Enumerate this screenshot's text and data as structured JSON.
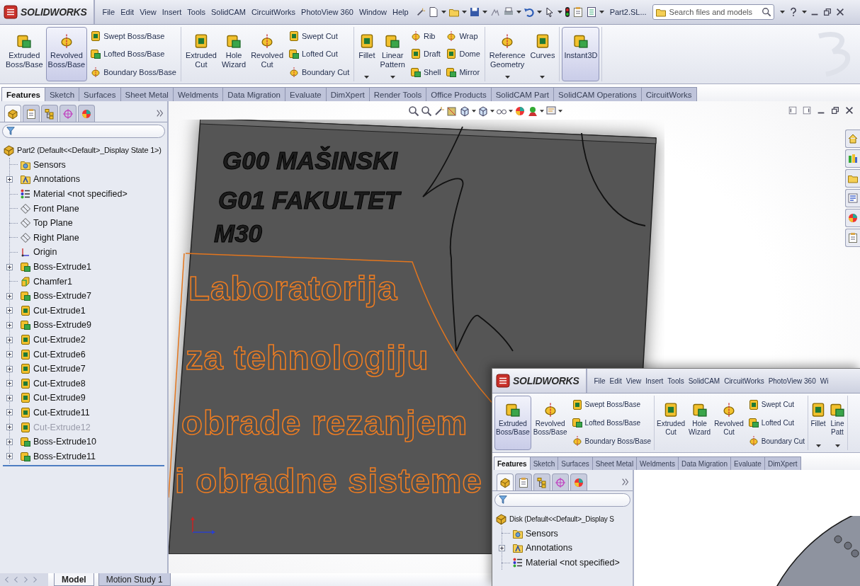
{
  "main_window": {
    "title_bar": {
      "app_name": "SOLIDWORKS",
      "menu": [
        "File",
        "Edit",
        "View",
        "Insert",
        "Tools",
        "SolidCAM",
        "CircuitWorks",
        "PhotoView 360",
        "Window",
        "Help"
      ],
      "document_title": "Part2.SL...",
      "search_placeholder": "Search files and models"
    },
    "ribbon": {
      "groups": [
        {
          "items": [
            {
              "kind": "large",
              "label": "Extruded Boss/Base",
              "selected": false,
              "has_menu": false
            },
            {
              "kind": "large",
              "label": "Revolved Boss/Base",
              "selected": true,
              "has_menu": false
            },
            {
              "kind": "stack",
              "buttons": [
                "Swept Boss/Base",
                "Lofted Boss/Base",
                "Boundary Boss/Base"
              ]
            }
          ]
        },
        {
          "items": [
            {
              "kind": "large",
              "label": "Extruded Cut",
              "selected": false,
              "has_menu": false
            },
            {
              "kind": "large",
              "label": "Hole Wizard",
              "selected": false,
              "has_menu": false
            },
            {
              "kind": "large",
              "label": "Revolved Cut",
              "selected": false,
              "has_menu": false
            },
            {
              "kind": "stack",
              "buttons": [
                "Swept Cut",
                "Lofted Cut",
                "Boundary Cut"
              ]
            }
          ]
        },
        {
          "items": [
            {
              "kind": "large",
              "label": "Fillet",
              "selected": false,
              "has_menu": true
            },
            {
              "kind": "large",
              "label": "Linear Pattern",
              "selected": false,
              "has_menu": true
            },
            {
              "kind": "stack",
              "buttons": [
                "Rib",
                "Draft",
                "Shell"
              ]
            },
            {
              "kind": "stack",
              "buttons": [
                "Wrap",
                "Dome",
                "Mirror"
              ]
            }
          ]
        },
        {
          "items": [
            {
              "kind": "large",
              "label": "Reference Geometry",
              "selected": false,
              "has_menu": true
            },
            {
              "kind": "large",
              "label": "Curves",
              "selected": false,
              "has_menu": true
            }
          ]
        },
        {
          "items": [
            {
              "kind": "large",
              "label": "Instant3D",
              "selected": true,
              "has_menu": false
            }
          ]
        }
      ]
    },
    "command_tabs": [
      {
        "label": "Features",
        "selected": true
      },
      {
        "label": "Sketch",
        "selected": false
      },
      {
        "label": "Surfaces",
        "selected": false
      },
      {
        "label": "Sheet Metal",
        "selected": false
      },
      {
        "label": "Weldments",
        "selected": false
      },
      {
        "label": "Data Migration",
        "selected": false
      },
      {
        "label": "Evaluate",
        "selected": false
      },
      {
        "label": "DimXpert",
        "selected": false
      },
      {
        "label": "Render Tools",
        "selected": false
      },
      {
        "label": "Office Products",
        "selected": false
      },
      {
        "label": "SolidCAM Part",
        "selected": false
      },
      {
        "label": "SolidCAM Operations",
        "selected": false
      },
      {
        "label": "CircuitWorks",
        "selected": false
      }
    ],
    "feature_tree": {
      "panel_tabs": [
        {
          "selected": true
        },
        {
          "selected": false
        },
        {
          "selected": false
        },
        {
          "selected": false
        },
        {
          "selected": false
        }
      ],
      "root": {
        "kind": "part",
        "label": "Part2  (Default<<Default>_Display State 1>)",
        "children": [
          {
            "kind": "sensors",
            "label": "Sensors",
            "collapsed": false,
            "suppressed": false
          },
          {
            "kind": "annotations",
            "label": "Annotations",
            "collapsed": true,
            "suppressed": false
          },
          {
            "kind": "material",
            "label": "Material <not specified>",
            "collapsed": false,
            "suppressed": false
          },
          {
            "kind": "plane",
            "label": "Front Plane",
            "collapsed": false,
            "suppressed": false
          },
          {
            "kind": "plane",
            "label": "Top Plane",
            "collapsed": false,
            "suppressed": false
          },
          {
            "kind": "plane",
            "label": "Right Plane",
            "collapsed": false,
            "suppressed": false
          },
          {
            "kind": "origin",
            "label": "Origin",
            "collapsed": false,
            "suppressed": false
          },
          {
            "kind": "boss",
            "label": "Boss-Extrude1",
            "collapsed": true,
            "suppressed": false
          },
          {
            "kind": "chamfer",
            "label": "Chamfer1",
            "collapsed": false,
            "suppressed": false
          },
          {
            "kind": "boss",
            "label": "Boss-Extrude7",
            "collapsed": true,
            "suppressed": false
          },
          {
            "kind": "cut",
            "label": "Cut-Extrude1",
            "collapsed": true,
            "suppressed": false
          },
          {
            "kind": "boss",
            "label": "Boss-Extrude9",
            "collapsed": true,
            "suppressed": false
          },
          {
            "kind": "cut",
            "label": "Cut-Extrude2",
            "collapsed": true,
            "suppressed": false
          },
          {
            "kind": "cut",
            "label": "Cut-Extrude6",
            "collapsed": true,
            "suppressed": false
          },
          {
            "kind": "cut",
            "label": "Cut-Extrude7",
            "collapsed": true,
            "suppressed": false
          },
          {
            "kind": "cut",
            "label": "Cut-Extrude8",
            "collapsed": true,
            "suppressed": false
          },
          {
            "kind": "cut",
            "label": "Cut-Extrude9",
            "collapsed": true,
            "suppressed": false
          },
          {
            "kind": "cut",
            "label": "Cut-Extrude11",
            "collapsed": true,
            "suppressed": false
          },
          {
            "kind": "cut",
            "label": "Cut-Extrude12",
            "collapsed": true,
            "suppressed": true
          },
          {
            "kind": "boss",
            "label": "Boss-Extrude10",
            "collapsed": true,
            "suppressed": false
          },
          {
            "kind": "boss",
            "label": "Boss-Extrude11",
            "collapsed": true,
            "suppressed": false
          }
        ]
      }
    },
    "graphics_area": {
      "engraved_text": [
        "G00 MAŠINSKI",
        "G01 FAKULTET",
        "M30"
      ],
      "outlined_text": [
        "Laboratorija",
        "za tehnologiju",
        "obrade rezanjem",
        "i obradne sisteme"
      ]
    },
    "bottom_tabs": [
      {
        "label": "Model",
        "selected": true
      },
      {
        "label": "Motion Study 1",
        "selected": false
      }
    ]
  },
  "overlay_window": {
    "title_bar": {
      "app_name": "SOLIDWORKS",
      "menu": [
        "File",
        "Edit",
        "View",
        "Insert",
        "Tools",
        "SolidCAM",
        "CircuitWorks",
        "PhotoView 360",
        "Wi"
      ]
    },
    "ribbon": {
      "groups": [
        {
          "items": [
            {
              "kind": "large",
              "label": "Extruded Boss/Base",
              "selected": true,
              "has_menu": false
            },
            {
              "kind": "large",
              "label": "Revolved Boss/Base",
              "selected": false,
              "has_menu": false
            },
            {
              "kind": "stack",
              "buttons": [
                "Swept Boss/Base",
                "Lofted Boss/Base",
                "Boundary Boss/Base"
              ]
            }
          ]
        },
        {
          "items": [
            {
              "kind": "large",
              "label": "Extruded Cut",
              "selected": false,
              "has_menu": false
            },
            {
              "kind": "large",
              "label": "Hole Wizard",
              "selected": false,
              "has_menu": false
            },
            {
              "kind": "large",
              "label": "Revolved Cut",
              "selected": false,
              "has_menu": false
            },
            {
              "kind": "stack",
              "buttons": [
                "Swept Cut",
                "Lofted Cut",
                "Boundary Cut"
              ]
            }
          ]
        },
        {
          "items": [
            {
              "kind": "large",
              "label": "Fillet",
              "selected": false,
              "has_menu": true
            },
            {
              "kind": "large",
              "label": "Line Patt",
              "selected": false,
              "has_menu": true
            }
          ]
        }
      ]
    },
    "command_tabs": [
      {
        "label": "Features",
        "selected": true
      },
      {
        "label": "Sketch",
        "selected": false
      },
      {
        "label": "Surfaces",
        "selected": false
      },
      {
        "label": "Sheet Metal",
        "selected": false
      },
      {
        "label": "Weldments",
        "selected": false
      },
      {
        "label": "Data Migration",
        "selected": false
      },
      {
        "label": "Evaluate",
        "selected": false
      },
      {
        "label": "DimXpert",
        "selected": false
      }
    ],
    "feature_tree": {
      "panel_tabs": [
        {
          "selected": true
        },
        {
          "selected": false
        },
        {
          "selected": false
        },
        {
          "selected": false
        },
        {
          "selected": false
        }
      ],
      "root": {
        "kind": "part",
        "label": "Disk  (Default<<Default>_Display S",
        "children": [
          {
            "kind": "sensors",
            "label": "Sensors",
            "collapsed": false,
            "suppressed": false
          },
          {
            "kind": "annotations",
            "label": "Annotations",
            "collapsed": true,
            "suppressed": false
          },
          {
            "kind": "material",
            "label": "Material <not specified>",
            "collapsed": false,
            "suppressed": false
          }
        ]
      }
    }
  }
}
